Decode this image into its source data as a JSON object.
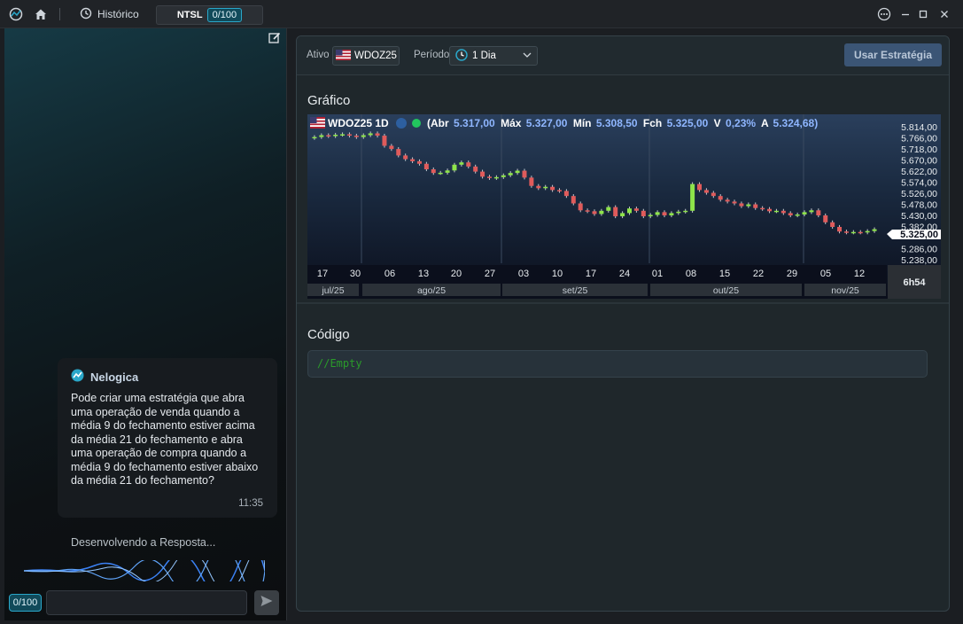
{
  "titlebar": {
    "history_label": "Histórico",
    "tab_label": "NTSL",
    "tab_counter": "0/100"
  },
  "chat": {
    "message": {
      "author": "Nelogica",
      "text": "Pode criar uma estratégia que abra uma operação de venda quando a média 9 do fechamento estiver acima da média 21 do fechamento e abra uma operação de compra quando a média 9 do fechamento estiver abaixo da média 21 do fechamento?",
      "time": "11:35"
    },
    "status": "Desenvolvendo a Resposta...",
    "counter": "0/100",
    "input_value": ""
  },
  "toolbar": {
    "asset_label": "Ativo",
    "asset_value": "WDOZ25",
    "period_label": "Período",
    "period_value": "1 Dia",
    "use_button": "Usar Estratégia"
  },
  "chart_section": {
    "title": "Gráfico"
  },
  "code_section": {
    "title": "Código",
    "code": "//Empty"
  },
  "chart_data": {
    "type": "candlestick",
    "header": {
      "symbol": "WDOZ25 1D",
      "abr_label": "(Abr",
      "abr": "5.317,00",
      "max_label": "Máx",
      "max": "5.327,00",
      "min_label": "Mín",
      "min": "5.308,50",
      "fch_label": "Fch",
      "fch": "5.325,00",
      "var_label": "V",
      "var": "0,23%",
      "a_label": "A",
      "a": "5.324,68)"
    },
    "last_price": "5.325,00",
    "countdown": "6h54",
    "ylim": [
      5230,
      5830
    ],
    "y_ticks": [
      "5.814,00",
      "5.766,00",
      "5.718,00",
      "5.670,00",
      "5.622,00",
      "5.574,00",
      "5.526,00",
      "5.478,00",
      "5.430,00",
      "5.382,00",
      "5.286,00",
      "5.238,00"
    ],
    "x_day_labels": [
      "17",
      "30",
      "06",
      "13",
      "20",
      "27",
      "03",
      "10",
      "17",
      "24",
      "01",
      "08",
      "15",
      "22",
      "29",
      "05",
      "12"
    ],
    "x_month_labels": [
      "jul/25",
      "ago/25",
      "set/25",
      "out/25",
      "nov/25"
    ],
    "colors": {
      "up": "#8ee44a",
      "down": "#e05b5b",
      "bg_top": "#2a3f5c",
      "bg_bottom": "#0b0f1c",
      "accent": "#2aa7c9"
    },
    "closes": [
      5770,
      5778,
      5774,
      5780,
      5782,
      5776,
      5770,
      5778,
      5786,
      5776,
      5732,
      5718,
      5690,
      5674,
      5665,
      5654,
      5630,
      5614,
      5615,
      5625,
      5650,
      5660,
      5642,
      5620,
      5598,
      5592,
      5596,
      5604,
      5614,
      5624,
      5594,
      5558,
      5548,
      5554,
      5540,
      5536,
      5514,
      5482,
      5452,
      5448,
      5436,
      5450,
      5466,
      5426,
      5440,
      5460,
      5450,
      5426,
      5432,
      5444,
      5430,
      5440,
      5446,
      5450,
      5566,
      5540,
      5528,
      5514,
      5498,
      5490,
      5482,
      5470,
      5478,
      5462,
      5458,
      5448,
      5450,
      5440,
      5430,
      5434,
      5444,
      5452,
      5430,
      5400,
      5380,
      5360,
      5356,
      5358,
      5356,
      5362,
      5370
    ]
  }
}
